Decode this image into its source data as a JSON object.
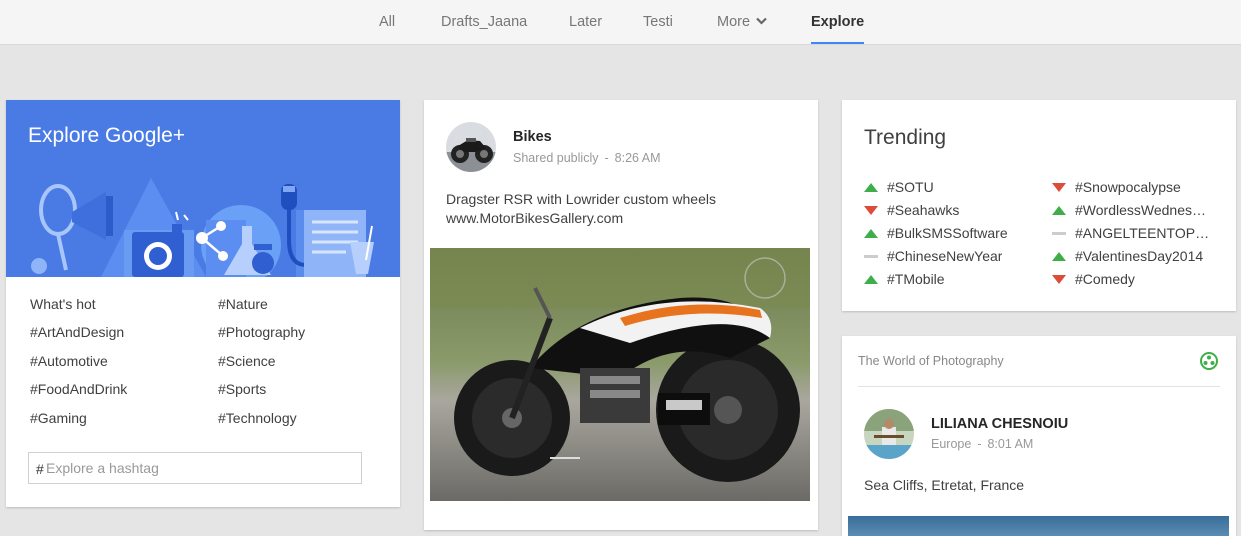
{
  "nav": {
    "tabs": [
      {
        "label": "All"
      },
      {
        "label": "Drafts_Jaana"
      },
      {
        "label": "Later"
      },
      {
        "label": "Testi"
      },
      {
        "label": "More"
      },
      {
        "label": "Explore"
      }
    ],
    "active": "Explore",
    "accent": "#4285f4"
  },
  "explore": {
    "title": "Explore Google+",
    "banner_color": "#4a7be5",
    "hashtags": [
      "What's hot",
      "#Nature",
      "#ArtAndDesign",
      "#Photography",
      "#Automotive",
      "#Science",
      "#FoodAndDrink",
      "#Sports",
      "#Gaming",
      "#Technology"
    ],
    "search": {
      "prefix": "#",
      "placeholder": "Explore a hashtag",
      "value": ""
    }
  },
  "post": {
    "author": "Bikes",
    "visibility": "Shared publicly",
    "separator": "-",
    "time": "8:26 AM",
    "text_line1": "Dragster RSR with Lowrider custom wheels",
    "text_line2": "www.MotorBikesGallery.com"
  },
  "trending": {
    "title": "Trending",
    "up_color": "#3fae49",
    "down_color": "#dd4b39",
    "flat_color": "#cccccc",
    "items": [
      {
        "tag": "#SOTU",
        "trend": "up"
      },
      {
        "tag": "#Snowpocalypse",
        "trend": "down"
      },
      {
        "tag": "#Seahawks",
        "trend": "down"
      },
      {
        "tag": "#WordlessWednesd…",
        "trend": "up"
      },
      {
        "tag": "#BulkSMSSoftware",
        "trend": "up"
      },
      {
        "tag": "#ANGELTEENTOP1…",
        "trend": "flat"
      },
      {
        "tag": "#ChineseNewYear",
        "trend": "flat"
      },
      {
        "tag": "#ValentinesDay2014",
        "trend": "up"
      },
      {
        "tag": "#TMobile",
        "trend": "up"
      },
      {
        "tag": "#Comedy",
        "trend": "down"
      }
    ]
  },
  "community_post": {
    "community": "The World of Photography",
    "author": "LILIANA CHESNOIU",
    "location": "Europe",
    "separator": "-",
    "time": "8:01 AM",
    "text": "Sea Cliffs, Etretat, France"
  }
}
